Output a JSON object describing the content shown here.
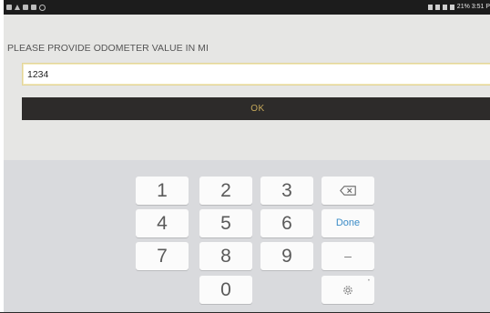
{
  "status_bar": {
    "right_text": "21% 3:51 P",
    "left_icons": [
      "notification-icon",
      "warning-icon",
      "image-icon",
      "cast-icon",
      "sync-icon"
    ],
    "right_icons": [
      "location-icon",
      "bluetooth-icon",
      "signal-icon",
      "battery-icon"
    ]
  },
  "form": {
    "prompt": "PLEASE PROVIDE ODOMETER VALUE IN MI",
    "odometer_value": "1234",
    "ok_label": "OK"
  },
  "keyboard": {
    "key_1": "1",
    "key_2": "2",
    "key_3": "3",
    "key_4": "4",
    "key_5": "5",
    "key_6": "6",
    "key_7": "7",
    "key_8": "8",
    "key_9": "9",
    "key_0": "0",
    "done_label": "Done",
    "minus_label": "–",
    "icons": [
      "backspace-icon",
      "settings-icon"
    ]
  },
  "colors": {
    "ok_background": "#2d2b2a",
    "ok_text": "#c5a85a",
    "done_text": "#3a8bc7",
    "keyboard_background": "#d9dadd",
    "input_border": "#e3d59a"
  }
}
